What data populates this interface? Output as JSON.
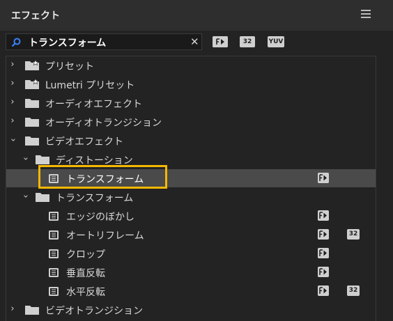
{
  "header": {
    "title": "エフェクト",
    "menu_icon": "hamburger-menu-icon"
  },
  "search": {
    "value": "トランスフォーム",
    "clear_label": "✕"
  },
  "filters": {
    "accelerated": "",
    "bit32": "32",
    "yuv": "YUV"
  },
  "colors": {
    "panel_bg": "#232323",
    "header_bg": "#2e2e2e",
    "selected_bg": "#4a4a4a",
    "highlight": "#f5b800"
  },
  "tree": {
    "presets": "プリセット",
    "lumetri_presets": "Lumetri プリセット",
    "audio_effects": "オーディオエフェクト",
    "audio_transitions": "オーディオトランジション",
    "video_effects": "ビデオエフェクト",
    "distortion": "ディストーション",
    "transform_effect": "トランスフォーム",
    "transform_folder": "トランスフォーム",
    "edge_blur": "エッジのぼかし",
    "auto_reframe": "オートリフレーム",
    "crop": "クロップ",
    "vertical_flip": "垂直反転",
    "horizontal_flip": "水平反転",
    "video_transitions": "ビデオトランジション"
  },
  "badge_32": "32"
}
